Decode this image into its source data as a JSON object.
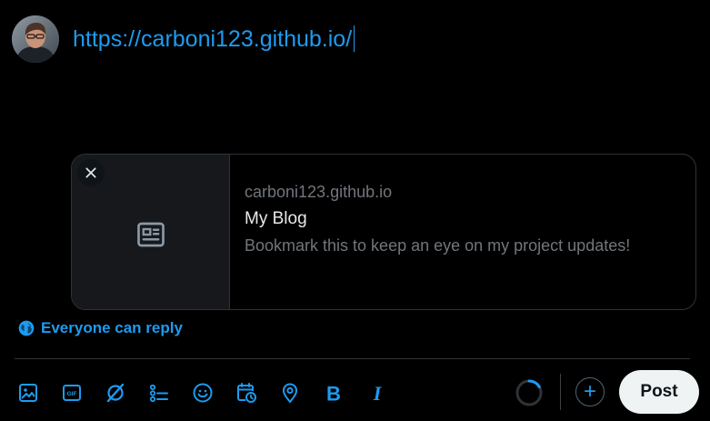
{
  "composer": {
    "text": "https://carboni123.github.io/"
  },
  "link_card": {
    "domain": "carboni123.github.io",
    "title": "My Blog",
    "description": "Bookmark this to keep an eye on my project updates!",
    "media_icon": "article-icon",
    "close_icon": "close-icon"
  },
  "reply_setting": {
    "label": "Everyone can reply",
    "icon": "globe-icon"
  },
  "toolbar": {
    "items": [
      "image-icon",
      "gif-icon",
      "grok-icon",
      "poll-icon",
      "emoji-icon",
      "schedule-icon",
      "location-icon",
      "bold-icon",
      "italic-icon"
    ],
    "gif_label": "GIF",
    "bold_label": "B",
    "italic_label": "I"
  },
  "composer_actions": {
    "add_label": "+",
    "post_label": "Post"
  },
  "colors": {
    "background": "#000000",
    "accent": "#1d9bf0",
    "primary_text": "#e7e9ea",
    "secondary_text": "#71767b",
    "border": "#2f3336",
    "post_button": "#eff3f4"
  }
}
